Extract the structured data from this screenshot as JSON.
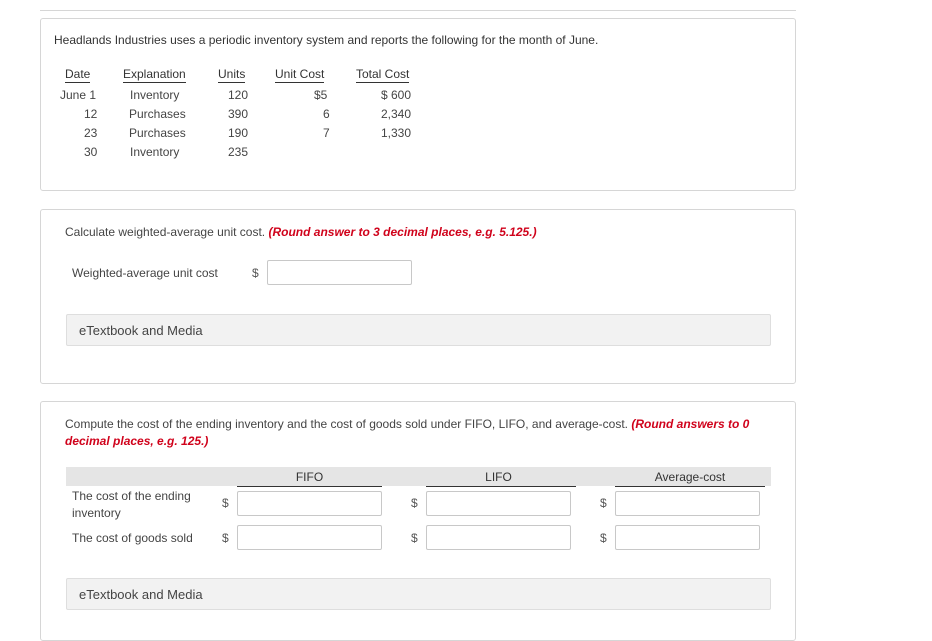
{
  "intro_text": "Headlands Industries uses a periodic inventory system and reports the following for the month of June.",
  "inventory_table": {
    "headers": [
      "Date",
      "Explanation",
      "Units",
      "Unit Cost",
      "Total Cost"
    ],
    "rows": [
      {
        "date": "June 1",
        "explanation": "Inventory",
        "units": "120",
        "unit_cost": "$5",
        "total_cost": "$ 600"
      },
      {
        "date": "12",
        "explanation": "Purchases",
        "units": "390",
        "unit_cost": "6",
        "total_cost": "2,340"
      },
      {
        "date": "23",
        "explanation": "Purchases",
        "units": "190",
        "unit_cost": "7",
        "total_cost": "1,330"
      },
      {
        "date": "30",
        "explanation": "Inventory",
        "units": "235",
        "unit_cost": "",
        "total_cost": ""
      }
    ]
  },
  "part1": {
    "prompt": "Calculate weighted-average unit cost.",
    "instruction": "(Round answer to 3 decimal places, e.g. 5.125.)",
    "label": "Weighted-average unit cost",
    "currency": "$",
    "value": "",
    "media_label": "eTextbook and Media"
  },
  "part2": {
    "prompt": "Compute the cost of the ending inventory and the cost of goods sold under FIFO, LIFO, and average-cost.",
    "instruction_line1": "(Round answers to 0",
    "instruction_line2": "decimal places, e.g. 125.)",
    "columns": [
      "FIFO",
      "LIFO",
      "Average-cost"
    ],
    "row_labels": [
      "The cost of the ending inventory",
      "The cost of goods sold"
    ],
    "currency": "$",
    "media_label": "eTextbook and Media"
  }
}
